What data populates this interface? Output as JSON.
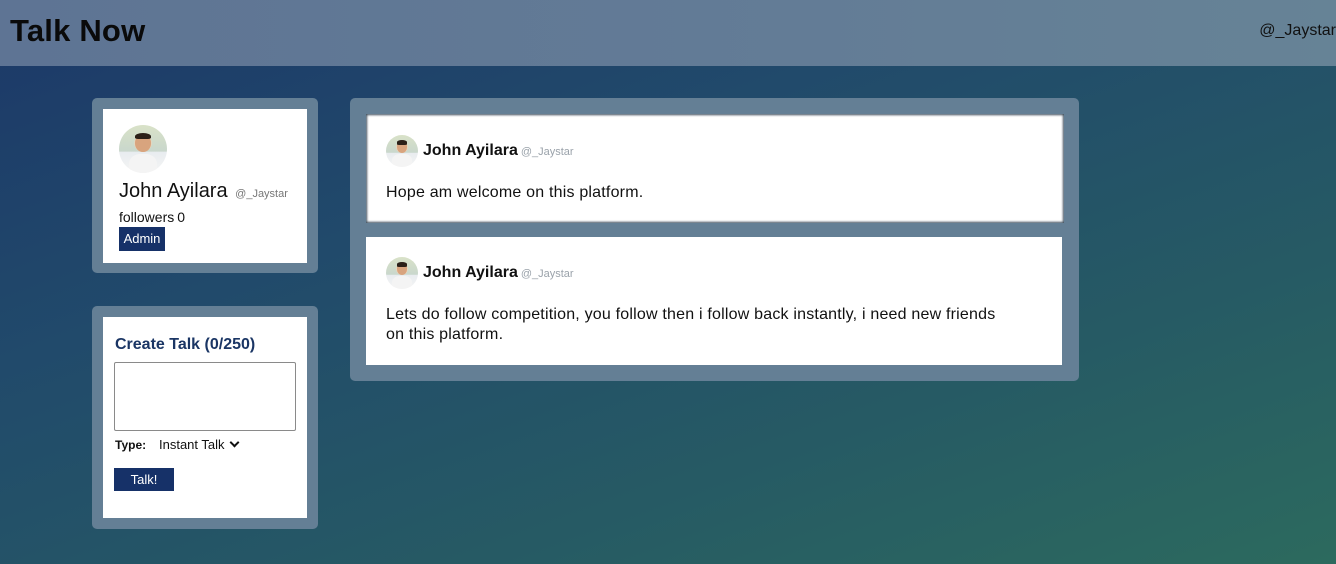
{
  "header": {
    "app_title": "Talk Now",
    "user_handle": "@_Jaystar"
  },
  "profile": {
    "name": "John Ayilara",
    "handle": "@_Jaystar",
    "followers_label": "followers",
    "followers_count": "0",
    "role_badge": "Admin"
  },
  "create_talk": {
    "title": "Create Talk (0/250)",
    "input_value": "",
    "type_label": "Type:",
    "type_selected": "Instant Talk",
    "submit_label": "Talk!"
  },
  "posts": [
    {
      "author": "John Ayilara",
      "handle": "@_Jaystar",
      "text": "Hope am welcome on this platform."
    },
    {
      "author": "John Ayilara",
      "handle": "@_Jaystar",
      "text": "Lets do follow competition, you follow then i follow back instantly, i need new friends on this platform."
    }
  ],
  "colors": {
    "accent": "#163168",
    "panel": "#647f95",
    "topbar": "#637c96"
  }
}
